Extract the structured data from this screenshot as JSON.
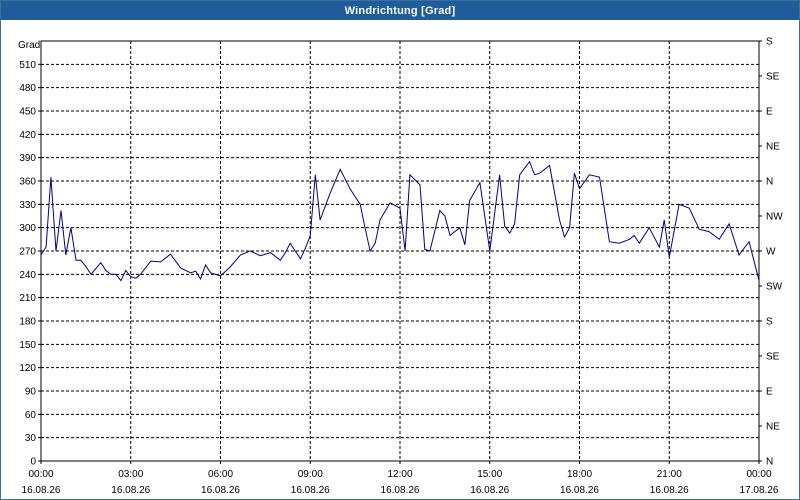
{
  "window": {
    "title": "Windrichtung [Grad]"
  },
  "chart_data": {
    "type": "line",
    "title": "Windrichtung [Grad]",
    "ylabel": "Grad",
    "ylim": [
      0,
      540
    ],
    "grid": true,
    "legend": "none",
    "colors": {
      "line": "#00008b",
      "grid": "#000000",
      "background": "#ffffff",
      "titlebar": "#1f5c99"
    },
    "y_ticks": [
      0,
      30,
      60,
      90,
      120,
      150,
      180,
      210,
      240,
      270,
      300,
      330,
      360,
      390,
      420,
      450,
      480,
      510
    ],
    "y2_ticks": [
      {
        "value": 0,
        "label": "N"
      },
      {
        "value": 45,
        "label": "NE"
      },
      {
        "value": 90,
        "label": "E"
      },
      {
        "value": 135,
        "label": "SE"
      },
      {
        "value": 180,
        "label": "S"
      },
      {
        "value": 225,
        "label": "SW"
      },
      {
        "value": 270,
        "label": "W"
      },
      {
        "value": 315,
        "label": "NW"
      },
      {
        "value": 360,
        "label": "N"
      },
      {
        "value": 405,
        "label": "NE"
      },
      {
        "value": 450,
        "label": "E"
      },
      {
        "value": 495,
        "label": "SE"
      },
      {
        "value": 540,
        "label": "S"
      }
    ],
    "x_ticks": [
      {
        "hour": 0,
        "time": "00:00",
        "date": "16.08.26"
      },
      {
        "hour": 3,
        "time": "03:00",
        "date": "16.08.26"
      },
      {
        "hour": 6,
        "time": "06:00",
        "date": "16.08.26"
      },
      {
        "hour": 9,
        "time": "09:00",
        "date": "16.08.26"
      },
      {
        "hour": 12,
        "time": "12:00",
        "date": "16.08.26"
      },
      {
        "hour": 15,
        "time": "15:00",
        "date": "16.08.26"
      },
      {
        "hour": 18,
        "time": "18:00",
        "date": "16.08.26"
      },
      {
        "hour": 21,
        "time": "21:00",
        "date": "16.08.26"
      },
      {
        "hour": 24,
        "time": "00:00",
        "date": "17.08.26"
      }
    ],
    "series": [
      {
        "x_hours": [
          0,
          0.17,
          0.33,
          0.5,
          0.67,
          0.83,
          1.0,
          1.17,
          1.33,
          1.5,
          1.67,
          2.0,
          2.17,
          2.33,
          2.5,
          2.67,
          2.83,
          3.0,
          3.17,
          3.33,
          3.67,
          4.0,
          4.33,
          4.67,
          5.0,
          5.17,
          5.33,
          5.5,
          5.67,
          6.0,
          6.17,
          6.33,
          6.67,
          7.0,
          7.33,
          7.67,
          8.0,
          8.17,
          8.33,
          8.67,
          8.83,
          9.0,
          9.17,
          9.33,
          9.67,
          10.0,
          10.33,
          10.67,
          10.83,
          11.0,
          11.17,
          11.33,
          11.67,
          12.0,
          12.17,
          12.33,
          12.67,
          12.83,
          13.0,
          13.33,
          13.5,
          13.67,
          14.0,
          14.17,
          14.33,
          14.67,
          15.0,
          15.33,
          15.5,
          15.67,
          15.83,
          16.0,
          16.33,
          16.5,
          16.67,
          17.0,
          17.33,
          17.5,
          17.67,
          17.83,
          18.0,
          18.33,
          18.67,
          19.0,
          19.33,
          19.67,
          19.83,
          20.0,
          20.33,
          20.67,
          20.83,
          21.0,
          21.33,
          21.67,
          22.0,
          22.33,
          22.67,
          23.0,
          23.33,
          23.67,
          24.0
        ],
        "values": [
          265,
          275,
          365,
          270,
          322,
          265,
          300,
          258,
          258,
          250,
          240,
          255,
          245,
          240,
          240,
          232,
          245,
          237,
          235,
          240,
          257,
          256,
          266,
          248,
          242,
          244,
          234,
          252,
          242,
          238,
          244,
          250,
          265,
          270,
          264,
          268,
          258,
          268,
          280,
          260,
          273,
          290,
          368,
          310,
          345,
          375,
          350,
          330,
          300,
          270,
          280,
          310,
          332,
          325,
          270,
          368,
          355,
          272,
          270,
          322,
          315,
          290,
          300,
          278,
          335,
          358,
          270,
          368,
          302,
          293,
          305,
          368,
          385,
          368,
          370,
          380,
          310,
          288,
          300,
          370,
          350,
          368,
          365,
          282,
          280,
          285,
          290,
          280,
          300,
          275,
          310,
          262,
          330,
          325,
          298,
          295,
          285,
          305,
          265,
          282,
          232
        ]
      }
    ]
  }
}
